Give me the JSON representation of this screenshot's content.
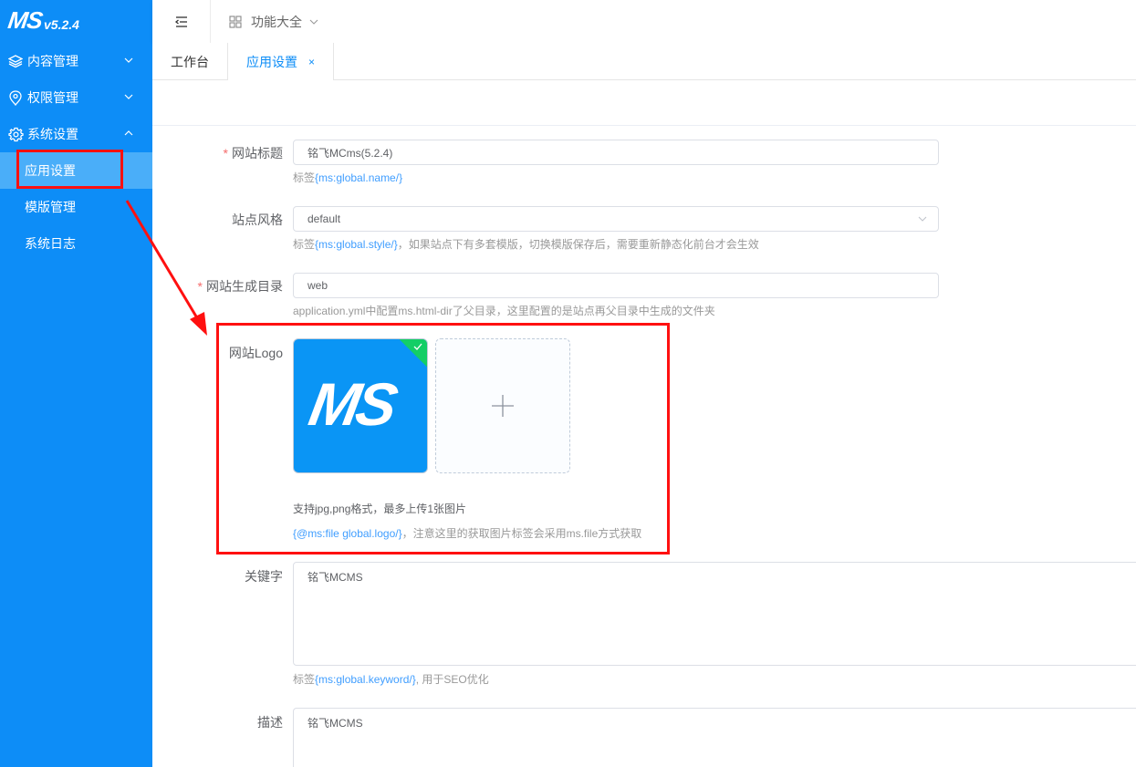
{
  "sidebar": {
    "logo_text": "MS",
    "version": "v5.2.4",
    "menus": [
      {
        "label": "内容管理",
        "icon": "layers-icon",
        "expanded": false
      },
      {
        "label": "权限管理",
        "icon": "shield-icon",
        "expanded": false
      },
      {
        "label": "系统设置",
        "icon": "gear-icon",
        "expanded": true
      }
    ],
    "sub_items": [
      {
        "label": "应用设置",
        "active": true
      },
      {
        "label": "模版管理",
        "active": false
      },
      {
        "label": "系统日志",
        "active": false
      }
    ]
  },
  "header": {
    "menu_icon": "menu-fold-icon",
    "func_label": "功能大全"
  },
  "tabs": [
    {
      "label": "工作台",
      "active": false
    },
    {
      "label": "应用设置",
      "active": true,
      "close": "×"
    }
  ],
  "form": {
    "site_title": {
      "label": "网站标题",
      "required": true,
      "value": "铭飞MCms(5.2.4)",
      "help_prefix": "标签",
      "help_tag": "{ms:global.name/}"
    },
    "site_style": {
      "label": "站点风格",
      "value": "default",
      "help_prefix": "标签",
      "help_tag": "{ms:global.style/}",
      "help_suffix": "，如果站点下有多套模版，切换模版保存后，需要重新静态化前台才会生效"
    },
    "site_dir": {
      "label": "网站生成目录",
      "required": true,
      "value": "web",
      "help": "application.yml中配置ms.html-dir了父目录，这里配置的是站点再父目录中生成的文件夹"
    },
    "site_logo": {
      "label": "网站Logo",
      "tip": "支持jpg,png格式，最多上传1张图片",
      "help_tag": "{@ms:file global.logo/}",
      "help_suffix": "，注意这里的获取图片标签会采用ms.file方式获取",
      "thumb_text": "MS"
    },
    "keywords": {
      "label": "关键字",
      "value": "铭飞MCMS",
      "help_prefix": "标签",
      "help_tag": "{ms:global.keyword/}",
      "help_suffix": ", 用于SEO优化"
    },
    "description": {
      "label": "描述",
      "value": "铭飞MCMS"
    }
  },
  "colors": {
    "sidebar_bg": "#0d8df7",
    "accent": "#409eff",
    "annotation": "#ff1010",
    "required": "#f56c6c"
  }
}
